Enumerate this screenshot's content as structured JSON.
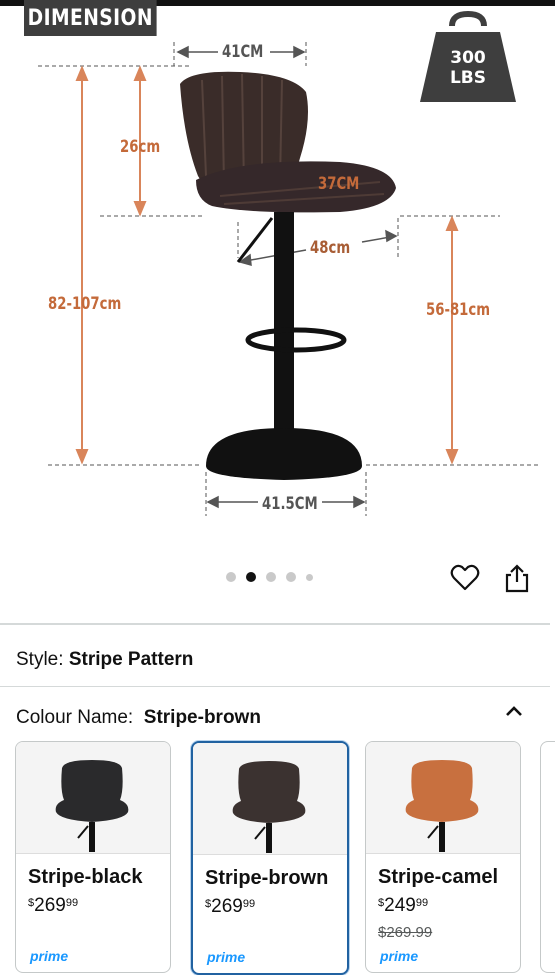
{
  "image_badges": {
    "title": "DIMENSION",
    "weight_top": "300",
    "weight_bottom": "LBS"
  },
  "dimensions": {
    "seat_width": "41CM",
    "back_height": "26cm",
    "seat_depth": "37CM",
    "seat_span": "48cm",
    "total_height": "82-107cm",
    "seat_height": "56-81cm",
    "base_width": "41.5CM"
  },
  "gallery": {
    "dot_count": 5,
    "active_index": 1
  },
  "style": {
    "label": "Style:",
    "value": "Stripe Pattern"
  },
  "colour": {
    "label": "Colour Name:",
    "value": "Stripe-brown"
  },
  "colours": {
    "accent_selected": "#2162a1",
    "dimension_text": "#c46a3a",
    "prime_blue": "#1a98ff"
  },
  "variants": [
    {
      "name": "Stripe-black",
      "currency": "$",
      "whole": "269",
      "fraction": "99",
      "old_price": "",
      "prime": "prime",
      "seat_color": "#2a2a2c",
      "selected": false
    },
    {
      "name": "Stripe-brown",
      "currency": "$",
      "whole": "269",
      "fraction": "99",
      "old_price": "",
      "prime": "prime",
      "seat_color": "#3b3230",
      "selected": true
    },
    {
      "name": "Stripe-camel",
      "currency": "$",
      "whole": "249",
      "fraction": "99",
      "old_price": "$269.99",
      "prime": "prime",
      "seat_color": "#c8703f",
      "selected": false
    }
  ]
}
